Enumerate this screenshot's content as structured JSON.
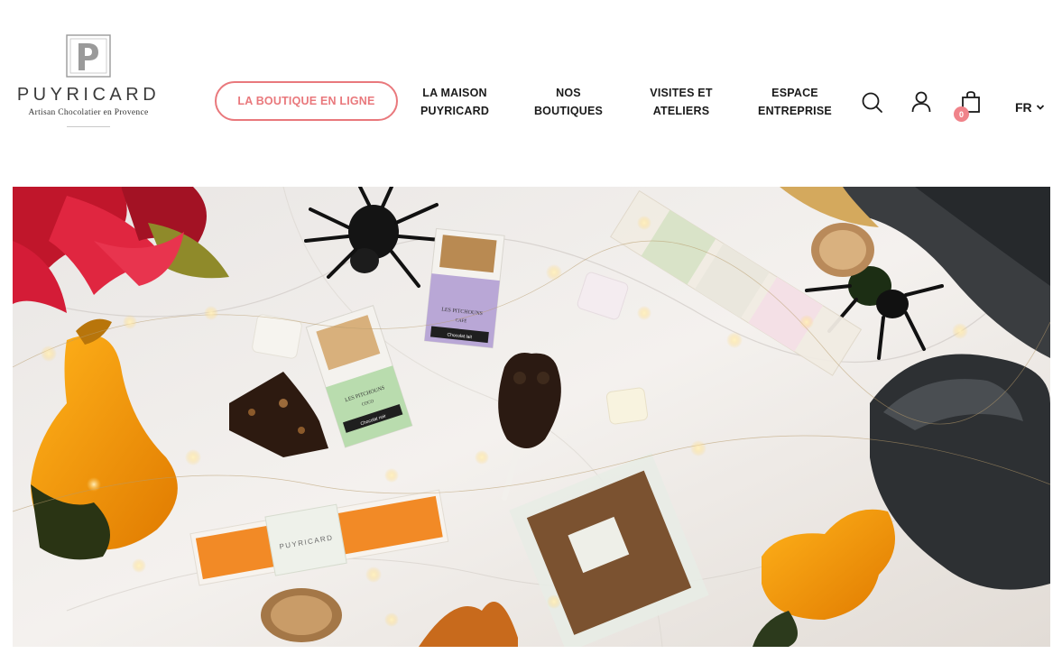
{
  "brand": {
    "monogram": "P",
    "name": "PUYRICARD",
    "tagline": "Artisan Chocolatier en Provence"
  },
  "nav": {
    "boutique_label": "LA BOUTIQUE EN LIGNE",
    "items": [
      {
        "line1": "LA MAISON",
        "line2": "PUYRICARD"
      },
      {
        "line1": "NOS",
        "line2": "BOUTIQUES"
      },
      {
        "line1": "VISITES ET",
        "line2": "ATELIERS"
      },
      {
        "line1": "ESPACE",
        "line2": "ENTREPRISE"
      }
    ]
  },
  "actions": {
    "search_icon": "search-icon",
    "account_icon": "user-icon",
    "cart_icon": "shopping-bag-icon",
    "cart_count": "0",
    "language": "FR"
  },
  "hero": {
    "packages": {
      "box_left_label_1": "LES PITCHOUNS",
      "box_left_label_2": "Chocolat noir",
      "box_mid_label_1": "LES PITCHOUNS",
      "box_mid_label_2": "Chocolat lait",
      "bar_label": "PUYRICARD",
      "box_left_flavor": "COCO",
      "box_mid_flavor": "CAFÉ"
    }
  },
  "colors": {
    "accent": "#e9787c",
    "badge": "#f0838a",
    "text": "#1a1a1a"
  }
}
